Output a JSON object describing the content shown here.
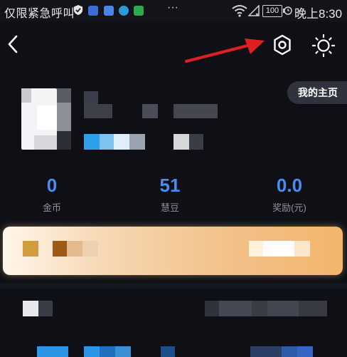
{
  "status_bar": {
    "carrier": "仅限紧急呼叫",
    "battery": "100",
    "time": "晚上8:30",
    "more": "···"
  },
  "header": {
    "back_icon": "chevron-left-icon",
    "settings_icon": "gear-icon",
    "theme_icon": "sun-icon",
    "my_homepage_label": "我的主页",
    "annotation_color": "#e02020"
  },
  "stats": [
    {
      "value": "0",
      "label": "金币"
    },
    {
      "value": "51",
      "label": "慧豆"
    },
    {
      "value": "0.0",
      "label": "奖励(元)"
    }
  ],
  "colors": {
    "background": "#0e1016",
    "accent": "#4a8cf2",
    "banner_orange": "#f3b56c"
  }
}
